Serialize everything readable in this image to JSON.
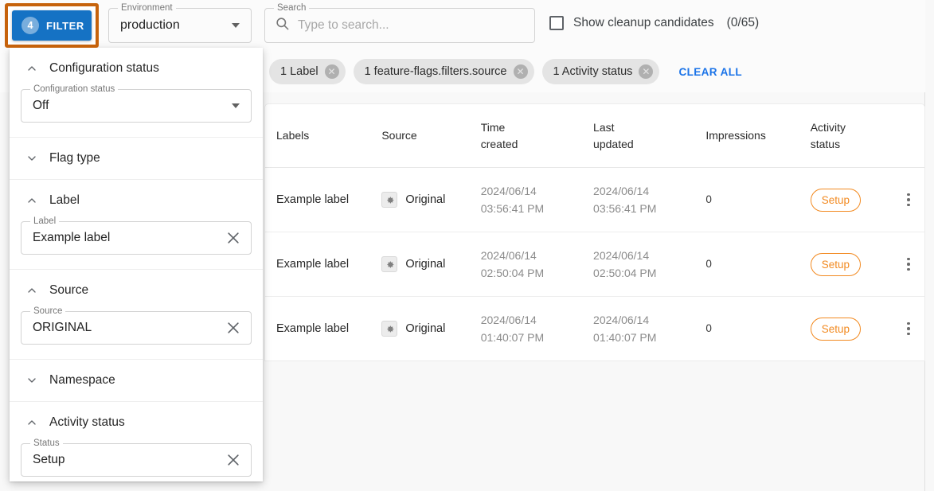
{
  "toolbar": {
    "filter_button": {
      "label": "FILTER",
      "badge": "4",
      "highlight_color": "#c6620b",
      "button_color": "#1572c4"
    },
    "environment": {
      "legend": "Environment",
      "value": "production"
    },
    "search": {
      "legend": "Search",
      "placeholder": "Type to search...",
      "value": "",
      "icon": "search-icon"
    },
    "cleanup": {
      "label": "Show cleanup candidates",
      "count": "(0/65)",
      "checked": false
    }
  },
  "chips": {
    "items": [
      {
        "label": "1 Label",
        "remove_icon": "close-circle-icon"
      },
      {
        "label": "1 feature-flags.filters.source",
        "remove_icon": "close-circle-icon"
      },
      {
        "label": "1 Activity status",
        "remove_icon": "close-circle-icon"
      }
    ],
    "clear_all": "CLEAR ALL",
    "clear_all_color": "#1a73e8"
  },
  "filter_panel": {
    "sections": [
      {
        "title": "Configuration status",
        "expanded": true,
        "chevron": "chevron-up-icon",
        "field": {
          "type": "select",
          "legend": "Configuration status",
          "value": "Off"
        }
      },
      {
        "title": "Flag type",
        "expanded": false,
        "chevron": "chevron-down-icon",
        "field": null
      },
      {
        "title": "Label",
        "expanded": true,
        "chevron": "chevron-up-icon",
        "field": {
          "type": "clearable",
          "legend": "Label",
          "value": "Example label"
        }
      },
      {
        "title": "Source",
        "expanded": true,
        "chevron": "chevron-up-icon",
        "field": {
          "type": "clearable",
          "legend": "Source",
          "value": "ORIGINAL"
        }
      },
      {
        "title": "Namespace",
        "expanded": false,
        "chevron": "chevron-down-icon",
        "field": null
      },
      {
        "title": "Activity status",
        "expanded": true,
        "chevron": "chevron-up-icon",
        "field": {
          "type": "clearable",
          "legend": "Status",
          "value": "Setup"
        }
      }
    ]
  },
  "table": {
    "columns": [
      {
        "line1": "Labels",
        "line2": ""
      },
      {
        "line1": "Source",
        "line2": ""
      },
      {
        "line1": "Time",
        "line2": "created"
      },
      {
        "line1": "Last",
        "line2": "updated"
      },
      {
        "line1": "Impressions",
        "line2": ""
      },
      {
        "line1": "Activity",
        "line2": "status"
      }
    ],
    "rows": [
      {
        "label": "Example label",
        "source": "Original",
        "source_icon": "gear-icon",
        "created_date": "2024/06/14",
        "created_time": "03:56:41 PM",
        "updated_date": "2024/06/14",
        "updated_time": "03:56:41 PM",
        "impressions": "0",
        "status": "Setup",
        "menu_icon": "kebab-menu-icon"
      },
      {
        "label": "Example label",
        "source": "Original",
        "source_icon": "gear-icon",
        "created_date": "2024/06/14",
        "created_time": "02:50:04 PM",
        "updated_date": "2024/06/14",
        "updated_time": "02:50:04 PM",
        "impressions": "0",
        "status": "Setup",
        "menu_icon": "kebab-menu-icon"
      },
      {
        "label": "Example label",
        "source": "Original",
        "source_icon": "gear-icon",
        "created_date": "2024/06/14",
        "created_time": "01:40:07 PM",
        "updated_date": "2024/06/14",
        "updated_time": "01:40:07 PM",
        "impressions": "0",
        "status": "Setup",
        "menu_icon": "kebab-menu-icon"
      }
    ],
    "status_color": "#f28a21"
  }
}
